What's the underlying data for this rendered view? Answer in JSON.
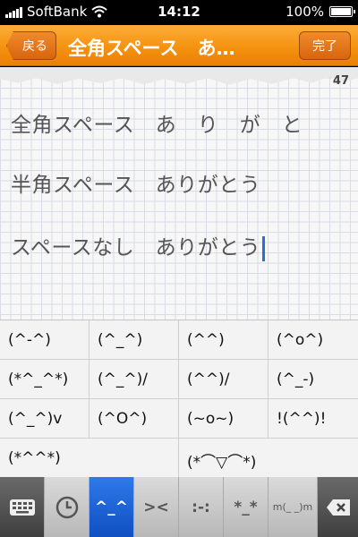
{
  "status_bar": {
    "carrier": "SoftBank",
    "time": "14:12",
    "battery": "100%"
  },
  "nav": {
    "back_label": "戻る",
    "title": "全角スペース　あ…",
    "done_label": "完了"
  },
  "editor": {
    "char_count": "47",
    "lines": [
      "全角スペース　あ　り　が　と",
      "半角スペース　ありがとう",
      "スペースなし　ありがとう"
    ]
  },
  "emoticons": [
    [
      "(^-^)",
      "(^_^)",
      "(^^)",
      "(^o^)"
    ],
    [
      "(*^_^*)",
      "(^_^)/",
      "(^^)/",
      "(^_-)"
    ],
    [
      "(^_^)v",
      "(^O^)",
      "(~o~)",
      "!(^^)!"
    ],
    [
      "(*^^*)",
      "(*⌒▽⌒*)"
    ]
  ],
  "tabs": [
    {
      "icon": "keyboard-icon"
    },
    {
      "icon": "clock-icon"
    },
    {
      "icon": "smile-face-icon",
      "glyph": "^_^"
    },
    {
      "icon": "frown-face-icon",
      "glyph": "><"
    },
    {
      "icon": "dot-face-icon",
      "glyph": ":-:"
    },
    {
      "icon": "star-face-icon",
      "glyph": "*_*"
    },
    {
      "icon": "bow-face-icon",
      "glyph": "m(_ _)m"
    },
    {
      "icon": "backspace-icon"
    }
  ],
  "colors": {
    "nav_orange": "#f59210",
    "active_tab": "#1f63d8",
    "caret": "#2b6fd6"
  }
}
